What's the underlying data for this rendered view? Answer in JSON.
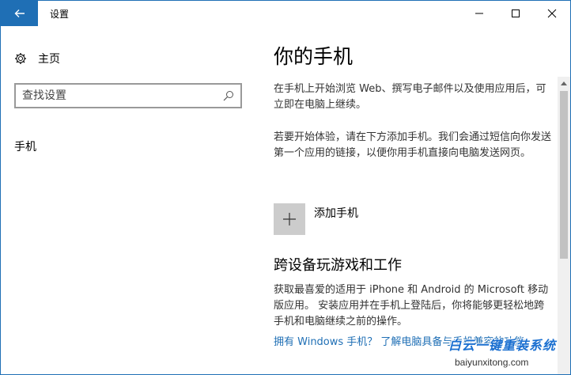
{
  "window": {
    "title": "设置"
  },
  "nav": {
    "home_label": "主页",
    "search_placeholder": "查找设置",
    "phone_label": "手机"
  },
  "content": {
    "title": "你的手机",
    "para1": "在手机上开始浏览 Web、撰写电子邮件以及使用应用后，可立即在电脑上继续。",
    "para2": "若要开始体验，请在下方添加手机。我们会通过短信向你发送第一个应用的链接，以便你用手机直接向电脑发送网页。",
    "add_phone_label": "添加手机",
    "section_title": "跨设备玩游戏和工作",
    "para3": "获取最喜爱的适用于 iPhone 和 Android 的 Microsoft 移动版应用。 安装应用并在手机上登陆后，你将能够更轻松地跨手机和电脑继续之前的操作。",
    "link_text": "拥有 Windows 手机？ 了解电脑具备与手机兼容的功能。"
  },
  "watermark": {
    "text": "白云一键重装系统",
    "url": "baiyunxitong.com"
  },
  "colors": {
    "accent": "#1f6fb5",
    "tile": "#cccccc"
  }
}
